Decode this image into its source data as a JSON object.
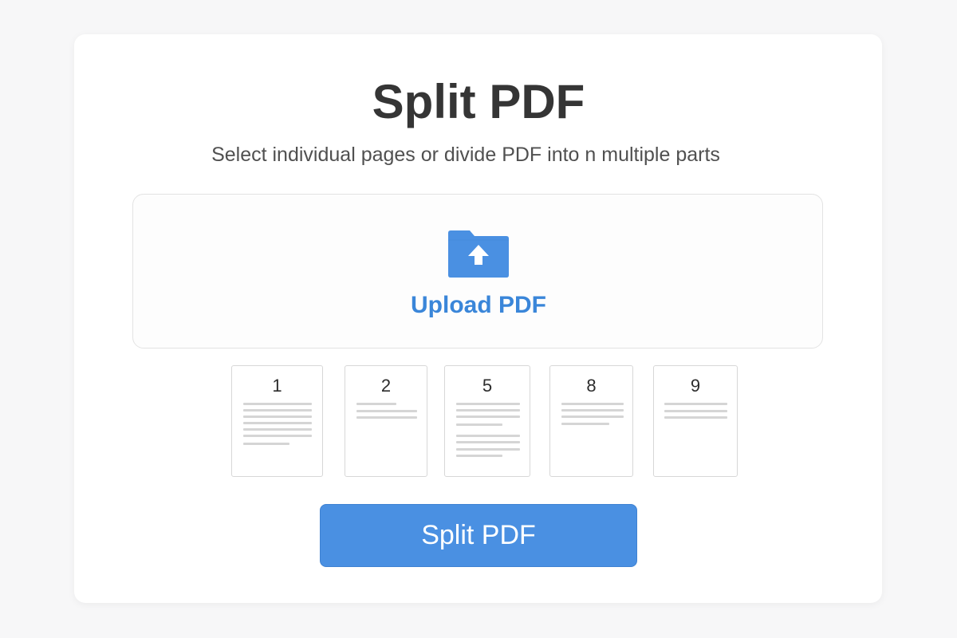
{
  "header": {
    "title": "Split PDF",
    "subtitle": "Select individual pages or divide PDF into n multiple parts"
  },
  "upload": {
    "label": "Upload PDF",
    "icon": "folder-upload-icon"
  },
  "pages": [
    {
      "number": "1"
    },
    {
      "number": "2"
    },
    {
      "number": "5"
    },
    {
      "number": "8"
    },
    {
      "number": "9"
    }
  ],
  "action": {
    "split_label": "Split PDF"
  },
  "colors": {
    "accent": "#4a90e2",
    "upload_text": "#3a86d9",
    "title_text": "#353535",
    "background": "#f7f7f8"
  }
}
